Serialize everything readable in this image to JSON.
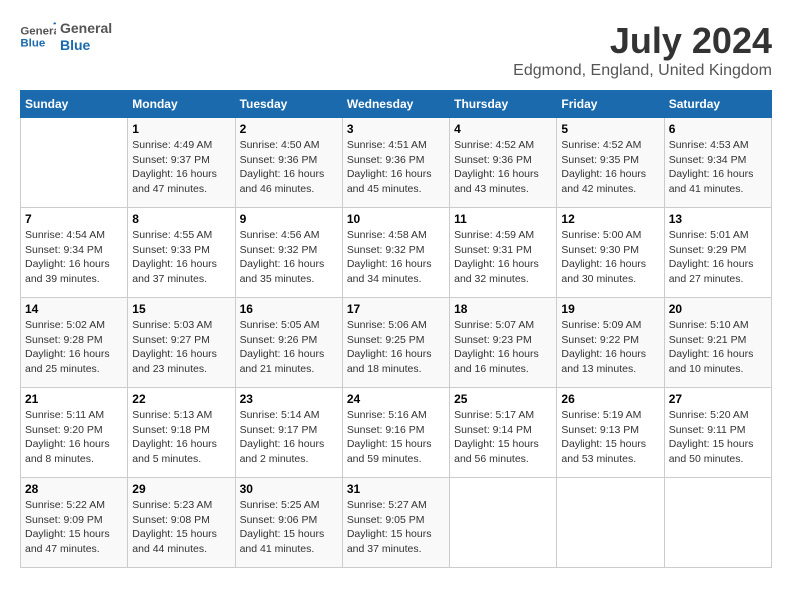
{
  "header": {
    "logo_line1": "General",
    "logo_line2": "Blue",
    "title": "July 2024",
    "subtitle": "Edgmond, England, United Kingdom"
  },
  "days_of_week": [
    "Sunday",
    "Monday",
    "Tuesday",
    "Wednesday",
    "Thursday",
    "Friday",
    "Saturday"
  ],
  "weeks": [
    [
      {
        "day": "",
        "info": ""
      },
      {
        "day": "1",
        "info": "Sunrise: 4:49 AM\nSunset: 9:37 PM\nDaylight: 16 hours\nand 47 minutes."
      },
      {
        "day": "2",
        "info": "Sunrise: 4:50 AM\nSunset: 9:36 PM\nDaylight: 16 hours\nand 46 minutes."
      },
      {
        "day": "3",
        "info": "Sunrise: 4:51 AM\nSunset: 9:36 PM\nDaylight: 16 hours\nand 45 minutes."
      },
      {
        "day": "4",
        "info": "Sunrise: 4:52 AM\nSunset: 9:36 PM\nDaylight: 16 hours\nand 43 minutes."
      },
      {
        "day": "5",
        "info": "Sunrise: 4:52 AM\nSunset: 9:35 PM\nDaylight: 16 hours\nand 42 minutes."
      },
      {
        "day": "6",
        "info": "Sunrise: 4:53 AM\nSunset: 9:34 PM\nDaylight: 16 hours\nand 41 minutes."
      }
    ],
    [
      {
        "day": "7",
        "info": "Sunrise: 4:54 AM\nSunset: 9:34 PM\nDaylight: 16 hours\nand 39 minutes."
      },
      {
        "day": "8",
        "info": "Sunrise: 4:55 AM\nSunset: 9:33 PM\nDaylight: 16 hours\nand 37 minutes."
      },
      {
        "day": "9",
        "info": "Sunrise: 4:56 AM\nSunset: 9:32 PM\nDaylight: 16 hours\nand 35 minutes."
      },
      {
        "day": "10",
        "info": "Sunrise: 4:58 AM\nSunset: 9:32 PM\nDaylight: 16 hours\nand 34 minutes."
      },
      {
        "day": "11",
        "info": "Sunrise: 4:59 AM\nSunset: 9:31 PM\nDaylight: 16 hours\nand 32 minutes."
      },
      {
        "day": "12",
        "info": "Sunrise: 5:00 AM\nSunset: 9:30 PM\nDaylight: 16 hours\nand 30 minutes."
      },
      {
        "day": "13",
        "info": "Sunrise: 5:01 AM\nSunset: 9:29 PM\nDaylight: 16 hours\nand 27 minutes."
      }
    ],
    [
      {
        "day": "14",
        "info": "Sunrise: 5:02 AM\nSunset: 9:28 PM\nDaylight: 16 hours\nand 25 minutes."
      },
      {
        "day": "15",
        "info": "Sunrise: 5:03 AM\nSunset: 9:27 PM\nDaylight: 16 hours\nand 23 minutes."
      },
      {
        "day": "16",
        "info": "Sunrise: 5:05 AM\nSunset: 9:26 PM\nDaylight: 16 hours\nand 21 minutes."
      },
      {
        "day": "17",
        "info": "Sunrise: 5:06 AM\nSunset: 9:25 PM\nDaylight: 16 hours\nand 18 minutes."
      },
      {
        "day": "18",
        "info": "Sunrise: 5:07 AM\nSunset: 9:23 PM\nDaylight: 16 hours\nand 16 minutes."
      },
      {
        "day": "19",
        "info": "Sunrise: 5:09 AM\nSunset: 9:22 PM\nDaylight: 16 hours\nand 13 minutes."
      },
      {
        "day": "20",
        "info": "Sunrise: 5:10 AM\nSunset: 9:21 PM\nDaylight: 16 hours\nand 10 minutes."
      }
    ],
    [
      {
        "day": "21",
        "info": "Sunrise: 5:11 AM\nSunset: 9:20 PM\nDaylight: 16 hours\nand 8 minutes."
      },
      {
        "day": "22",
        "info": "Sunrise: 5:13 AM\nSunset: 9:18 PM\nDaylight: 16 hours\nand 5 minutes."
      },
      {
        "day": "23",
        "info": "Sunrise: 5:14 AM\nSunset: 9:17 PM\nDaylight: 16 hours\nand 2 minutes."
      },
      {
        "day": "24",
        "info": "Sunrise: 5:16 AM\nSunset: 9:16 PM\nDaylight: 15 hours\nand 59 minutes."
      },
      {
        "day": "25",
        "info": "Sunrise: 5:17 AM\nSunset: 9:14 PM\nDaylight: 15 hours\nand 56 minutes."
      },
      {
        "day": "26",
        "info": "Sunrise: 5:19 AM\nSunset: 9:13 PM\nDaylight: 15 hours\nand 53 minutes."
      },
      {
        "day": "27",
        "info": "Sunrise: 5:20 AM\nSunset: 9:11 PM\nDaylight: 15 hours\nand 50 minutes."
      }
    ],
    [
      {
        "day": "28",
        "info": "Sunrise: 5:22 AM\nSunset: 9:09 PM\nDaylight: 15 hours\nand 47 minutes."
      },
      {
        "day": "29",
        "info": "Sunrise: 5:23 AM\nSunset: 9:08 PM\nDaylight: 15 hours\nand 44 minutes."
      },
      {
        "day": "30",
        "info": "Sunrise: 5:25 AM\nSunset: 9:06 PM\nDaylight: 15 hours\nand 41 minutes."
      },
      {
        "day": "31",
        "info": "Sunrise: 5:27 AM\nSunset: 9:05 PM\nDaylight: 15 hours\nand 37 minutes."
      },
      {
        "day": "",
        "info": ""
      },
      {
        "day": "",
        "info": ""
      },
      {
        "day": "",
        "info": ""
      }
    ]
  ]
}
